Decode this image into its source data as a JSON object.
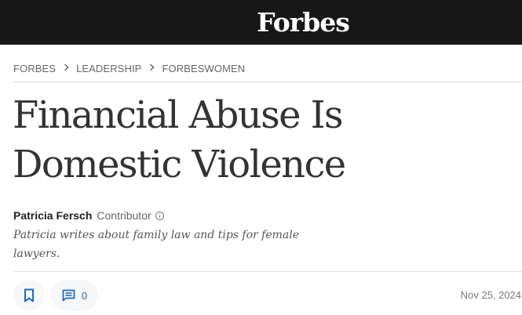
{
  "header": {
    "logo": "Forbes",
    "background": "#181818"
  },
  "breadcrumb": [
    {
      "label": "FORBES"
    },
    {
      "label": "LEADERSHIP"
    },
    {
      "label": "FORBESWOMEN"
    }
  ],
  "article": {
    "headline": "Financial Abuse Is Domestic Violence",
    "author": "Patricia Fersch",
    "role": "Contributor",
    "bio": "Patricia writes about family law and tips for female lawyers.",
    "comment_count": "0",
    "date": "Nov 25, 2024"
  },
  "icons": {
    "bookmark": "bookmark-icon",
    "comment": "comment-icon",
    "info": "info-icon",
    "separator": "chevron-right-icon"
  },
  "colors": {
    "accent": "#1b6bbf",
    "text": "#333333"
  }
}
